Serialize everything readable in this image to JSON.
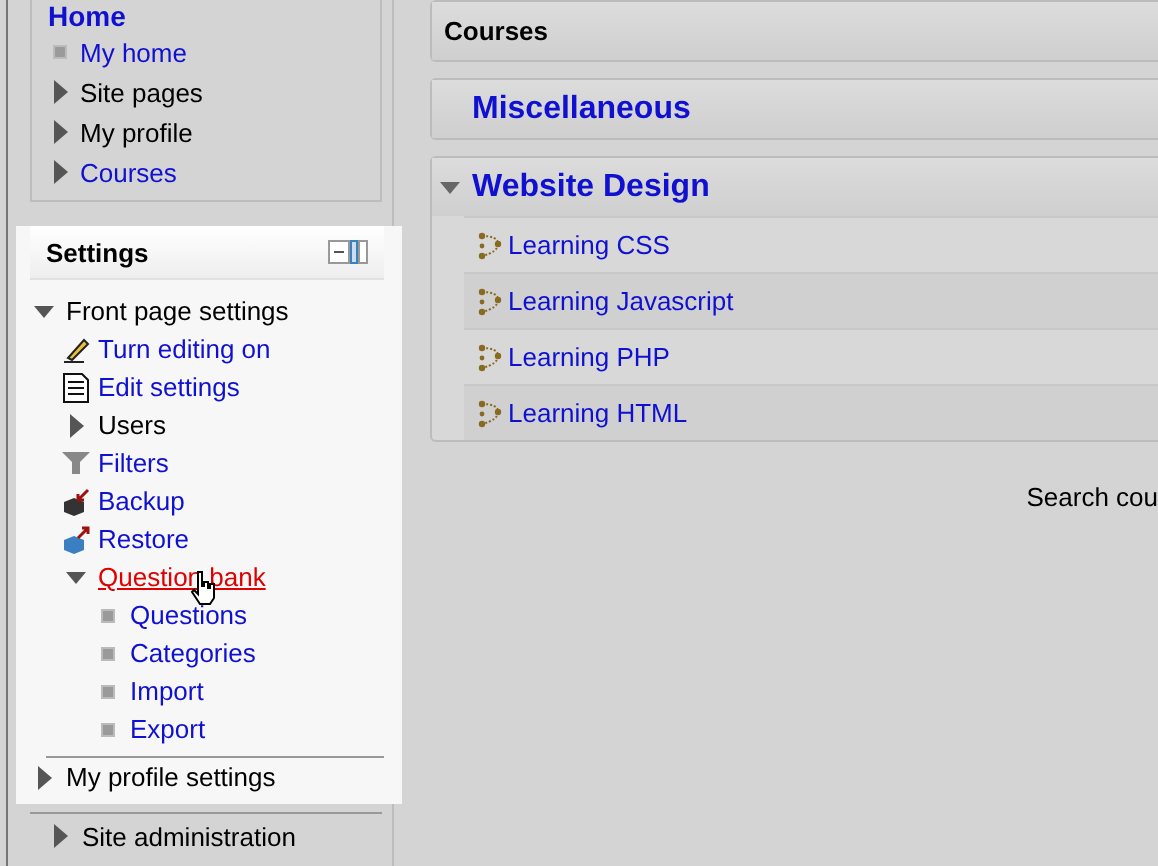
{
  "navigation": {
    "title": "Home",
    "items": [
      {
        "label": "My home",
        "kind": "leaf",
        "link": true
      },
      {
        "label": "Site pages",
        "kind": "branch",
        "expanded": false,
        "link": false
      },
      {
        "label": "My profile",
        "kind": "branch",
        "expanded": false,
        "link": false
      },
      {
        "label": "Courses",
        "kind": "branch",
        "expanded": false,
        "link": true
      }
    ]
  },
  "settings": {
    "title": "Settings",
    "items": [
      {
        "label": "Front page settings",
        "kind": "branch",
        "expanded": true,
        "link": false,
        "children": [
          {
            "label": "Turn editing on",
            "kind": "edit",
            "link": true,
            "hovered": false
          },
          {
            "label": "Edit settings",
            "kind": "document",
            "link": true,
            "hovered": false
          },
          {
            "label": "Users",
            "kind": "branch",
            "expanded": false,
            "link": false,
            "hovered": false
          },
          {
            "label": "Filters",
            "kind": "filter",
            "link": true,
            "hovered": false
          },
          {
            "label": "Backup",
            "kind": "backup",
            "link": true,
            "hovered": false
          },
          {
            "label": "Restore",
            "kind": "restore",
            "link": true,
            "hovered": false
          },
          {
            "label": "Question bank",
            "kind": "branch",
            "expanded": true,
            "link": true,
            "hovered": true,
            "children": [
              {
                "label": "Questions",
                "kind": "leaf",
                "link": true
              },
              {
                "label": "Categories",
                "kind": "leaf",
                "link": true
              },
              {
                "label": "Import",
                "kind": "leaf",
                "link": true
              },
              {
                "label": "Export",
                "kind": "leaf",
                "link": true
              }
            ]
          }
        ]
      },
      {
        "label": "My profile settings",
        "kind": "branch",
        "expanded": false,
        "link": false
      },
      {
        "label": "Site administration",
        "kind": "branch",
        "expanded": false,
        "link": false
      }
    ]
  },
  "courses": {
    "title": "Courses",
    "categories": [
      {
        "name": "Miscellaneous"
      },
      {
        "name": "Website Design",
        "expanded": true,
        "courses": [
          "Learning CSS",
          "Learning Javascript",
          "Learning PHP",
          "Learning HTML"
        ]
      }
    ],
    "search_label": "Search cou"
  }
}
